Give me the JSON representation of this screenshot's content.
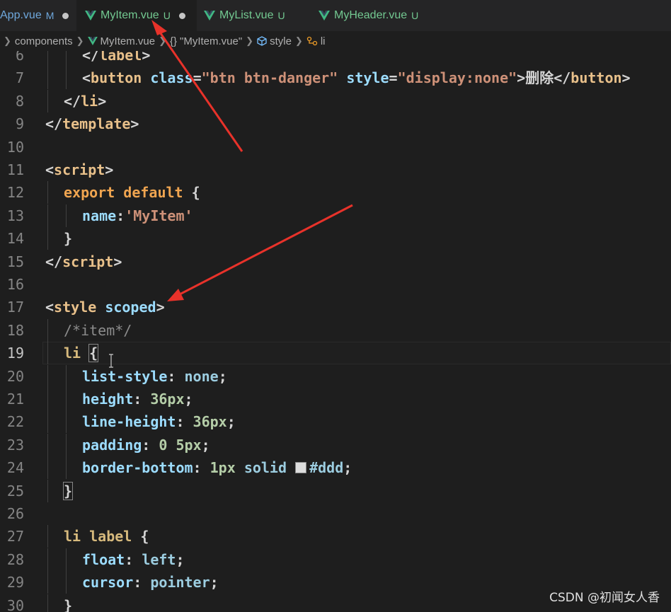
{
  "tabs": [
    {
      "name": "App.vue",
      "status": "M",
      "dirty": true
    },
    {
      "name": "MyItem.vue",
      "status": "U",
      "dirty": true,
      "active": true
    },
    {
      "name": "MyList.vue",
      "status": "U"
    },
    {
      "name": "MyHeader.vue",
      "status": "U"
    }
  ],
  "breadcrumb": {
    "folder": "components",
    "file": "MyItem.vue",
    "braces": "{}",
    "section": "\"MyItem.vue\"",
    "style": "style",
    "element": "li"
  },
  "editor": {
    "current_line": "19",
    "lines": [
      {
        "n": "6",
        "parts": [
          [
            "t-tag",
            "</"
          ],
          [
            "t-tagname",
            "label"
          ],
          [
            "t-tag",
            ">"
          ]
        ],
        "indent": 2
      },
      {
        "n": "7",
        "parts": [
          [
            "t-tag",
            "<"
          ],
          [
            "t-tagname",
            "button"
          ],
          [
            "t-pun",
            " "
          ],
          [
            "t-attr",
            "class"
          ],
          [
            "t-pun",
            "="
          ],
          [
            "t-str",
            "\"btn btn-danger\""
          ],
          [
            "t-pun",
            " "
          ],
          [
            "t-attr",
            "style"
          ],
          [
            "t-pun",
            "="
          ],
          [
            "t-str",
            "\"display:none\""
          ],
          [
            "t-tag",
            ">"
          ],
          [
            "t-zh",
            "删除"
          ],
          [
            "t-tag",
            "</"
          ],
          [
            "t-tagname",
            "button"
          ],
          [
            "t-tag",
            ">"
          ]
        ],
        "indent": 2
      },
      {
        "n": "8",
        "parts": [
          [
            "t-tag",
            "</"
          ],
          [
            "t-tagname",
            "li"
          ],
          [
            "t-tag",
            ">"
          ]
        ],
        "indent": 1
      },
      {
        "n": "9",
        "parts": [
          [
            "t-tag",
            "</"
          ],
          [
            "t-tagname",
            "template"
          ],
          [
            "t-tag",
            ">"
          ]
        ],
        "indent": 0
      },
      {
        "n": "10",
        "parts": [],
        "indent": 0
      },
      {
        "n": "11",
        "parts": [
          [
            "t-tag",
            "<"
          ],
          [
            "t-tagname",
            "script"
          ],
          [
            "t-tag",
            ">"
          ]
        ],
        "indent": 0
      },
      {
        "n": "12",
        "parts": [
          [
            "t-kw",
            "export"
          ],
          [
            "t-pun",
            " "
          ],
          [
            "t-kw",
            "default"
          ],
          [
            "t-pun",
            " {"
          ]
        ],
        "indent": 1
      },
      {
        "n": "13",
        "parts": [
          [
            "t-prop",
            "name"
          ],
          [
            "t-pun",
            ":"
          ],
          [
            "t-str",
            "'MyItem'"
          ]
        ],
        "indent": 2
      },
      {
        "n": "14",
        "parts": [
          [
            "t-pun",
            "}"
          ]
        ],
        "indent": 1
      },
      {
        "n": "15",
        "parts": [
          [
            "t-tag",
            "</"
          ],
          [
            "t-tagname",
            "script"
          ],
          [
            "t-tag",
            ">"
          ]
        ],
        "indent": 0
      },
      {
        "n": "16",
        "parts": [],
        "indent": 0
      },
      {
        "n": "17",
        "parts": [
          [
            "t-tag",
            "<"
          ],
          [
            "t-tagname",
            "style"
          ],
          [
            "t-pun",
            " "
          ],
          [
            "t-attr",
            "scoped"
          ],
          [
            "t-tag",
            ">"
          ]
        ],
        "indent": 0
      },
      {
        "n": "18",
        "parts": [
          [
            "t-com",
            "/*item*/"
          ]
        ],
        "indent": 1
      },
      {
        "n": "19",
        "parts": [
          [
            "t-sel",
            "li"
          ],
          [
            "t-pun",
            " "
          ],
          [
            "t-pun brk",
            "{"
          ]
        ],
        "indent": 1
      },
      {
        "n": "20",
        "parts": [
          [
            "t-prop",
            "list-style"
          ],
          [
            "t-pun",
            ": "
          ],
          [
            "t-val",
            "none"
          ],
          [
            "t-pun",
            ";"
          ]
        ],
        "indent": 2
      },
      {
        "n": "21",
        "parts": [
          [
            "t-prop",
            "height"
          ],
          [
            "t-pun",
            ": "
          ],
          [
            "t-num",
            "36px"
          ],
          [
            "t-pun",
            ";"
          ]
        ],
        "indent": 2
      },
      {
        "n": "22",
        "parts": [
          [
            "t-prop",
            "line-height"
          ],
          [
            "t-pun",
            ": "
          ],
          [
            "t-num",
            "36px"
          ],
          [
            "t-pun",
            ";"
          ]
        ],
        "indent": 2
      },
      {
        "n": "23",
        "parts": [
          [
            "t-prop",
            "padding"
          ],
          [
            "t-pun",
            ": "
          ],
          [
            "t-num",
            "0 5px"
          ],
          [
            "t-pun",
            ";"
          ]
        ],
        "indent": 2
      },
      {
        "n": "24",
        "parts": [
          [
            "t-prop",
            "border-bottom"
          ],
          [
            "t-pun",
            ": "
          ],
          [
            "t-num",
            "1px"
          ],
          [
            "t-pun",
            " "
          ],
          [
            "t-val",
            "solid"
          ],
          [
            "t-pun",
            " "
          ],
          [
            "swatch",
            ""
          ],
          [
            "t-val",
            "#ddd"
          ],
          [
            "t-pun",
            ";"
          ]
        ],
        "indent": 2
      },
      {
        "n": "25",
        "parts": [
          [
            "t-pun brk",
            "}"
          ]
        ],
        "indent": 1
      },
      {
        "n": "26",
        "parts": [],
        "indent": 0
      },
      {
        "n": "27",
        "parts": [
          [
            "t-sel",
            "li label"
          ],
          [
            "t-pun",
            " {"
          ]
        ],
        "indent": 1
      },
      {
        "n": "28",
        "parts": [
          [
            "t-prop",
            "float"
          ],
          [
            "t-pun",
            ": "
          ],
          [
            "t-val",
            "left"
          ],
          [
            "t-pun",
            ";"
          ]
        ],
        "indent": 2
      },
      {
        "n": "29",
        "parts": [
          [
            "t-prop",
            "cursor"
          ],
          [
            "t-pun",
            ": "
          ],
          [
            "t-val",
            "pointer"
          ],
          [
            "t-pun",
            ";"
          ]
        ],
        "indent": 2
      },
      {
        "n": "30",
        "parts": [
          [
            "t-pun",
            "}"
          ]
        ],
        "indent": 1
      }
    ]
  },
  "watermark": "CSDN @初闻女人香",
  "colors": {
    "arrow": "#e8322a",
    "editor_bg": "#1e1e1e",
    "tab_bg": "#252526"
  },
  "icons": {
    "tab_file": "vue-icon",
    "dirty": "dot-icon"
  }
}
